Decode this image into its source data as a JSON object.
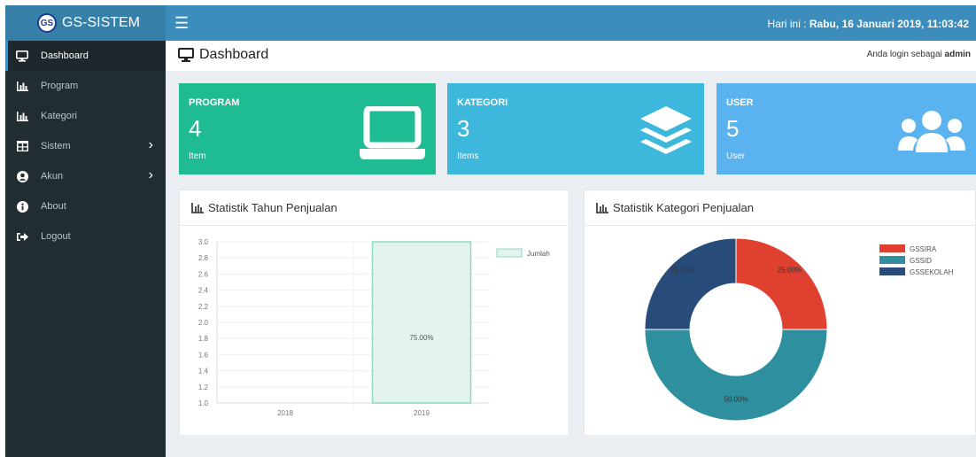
{
  "app": {
    "logo_text": "GS",
    "title": "GS-SISTEM"
  },
  "header": {
    "clock_prefix": "Hari ini : ",
    "clock_value": "Rabu, 16 Januari 2019, 11:03:42"
  },
  "sidebar": {
    "items": [
      {
        "label": "Dashboard",
        "icon": "monitor-icon",
        "active": true,
        "has_arrow": false
      },
      {
        "label": "Program",
        "icon": "bar-chart-icon",
        "active": false,
        "has_arrow": false
      },
      {
        "label": "Kategori",
        "icon": "bar-chart-icon",
        "active": false,
        "has_arrow": false
      },
      {
        "label": "Sistem",
        "icon": "grid-icon",
        "active": false,
        "has_arrow": true
      },
      {
        "label": "Akun",
        "icon": "user-circle-icon",
        "active": false,
        "has_arrow": true
      },
      {
        "label": "About",
        "icon": "info-icon",
        "active": false,
        "has_arrow": false
      },
      {
        "label": "Logout",
        "icon": "sign-out-icon",
        "active": false,
        "has_arrow": false
      }
    ]
  },
  "page": {
    "title": "Dashboard",
    "login_prefix": "Anda login sebagai ",
    "login_user": "admin"
  },
  "boxes": [
    {
      "title": "PROGRAM",
      "value": "4",
      "sub": "Item",
      "color": "#1fbc94",
      "icon": "laptop-icon"
    },
    {
      "title": "KATEGORI",
      "value": "3",
      "sub": "Items",
      "color": "#3db7dc",
      "icon": "layers-icon"
    },
    {
      "title": "USER",
      "value": "5",
      "sub": "User",
      "color": "#5ab2ee",
      "icon": "users-icon"
    }
  ],
  "panels": {
    "year": {
      "title": "Statistik Tahun Penjualan"
    },
    "category": {
      "title": "Statistik Kategori Penjualan"
    }
  },
  "chart_data": [
    {
      "type": "bar",
      "title": "Statistik Tahun Penjualan",
      "categories": [
        "2018",
        "2019"
      ],
      "series": [
        {
          "name": "Jumlah",
          "values": [
            null,
            3.0
          ]
        }
      ],
      "data_labels": [
        "",
        "75.00%"
      ],
      "ylim": [
        1.0,
        3.0
      ],
      "yticks": [
        "3.0",
        "2.8",
        "2.6",
        "2.4",
        "2.2",
        "2.0",
        "1.8",
        "1.6",
        "1.4",
        "1.2",
        "1.0"
      ],
      "legend": "top-right",
      "grid": true,
      "colors": {
        "fill": "#e2f3f0",
        "stroke": "#8fd8c8"
      }
    },
    {
      "type": "pie",
      "title": "Statistik Kategori Penjualan",
      "labels": [
        "GSSIRA",
        "GSSID",
        "GSSEKOLAH"
      ],
      "values": [
        25,
        50,
        25
      ],
      "data_labels": [
        "25.00%",
        "50.00%",
        "25.00%"
      ],
      "colors": [
        "#e0402f",
        "#2e8f9e",
        "#284c7a"
      ],
      "legend": "top-right",
      "donut": true
    }
  ]
}
